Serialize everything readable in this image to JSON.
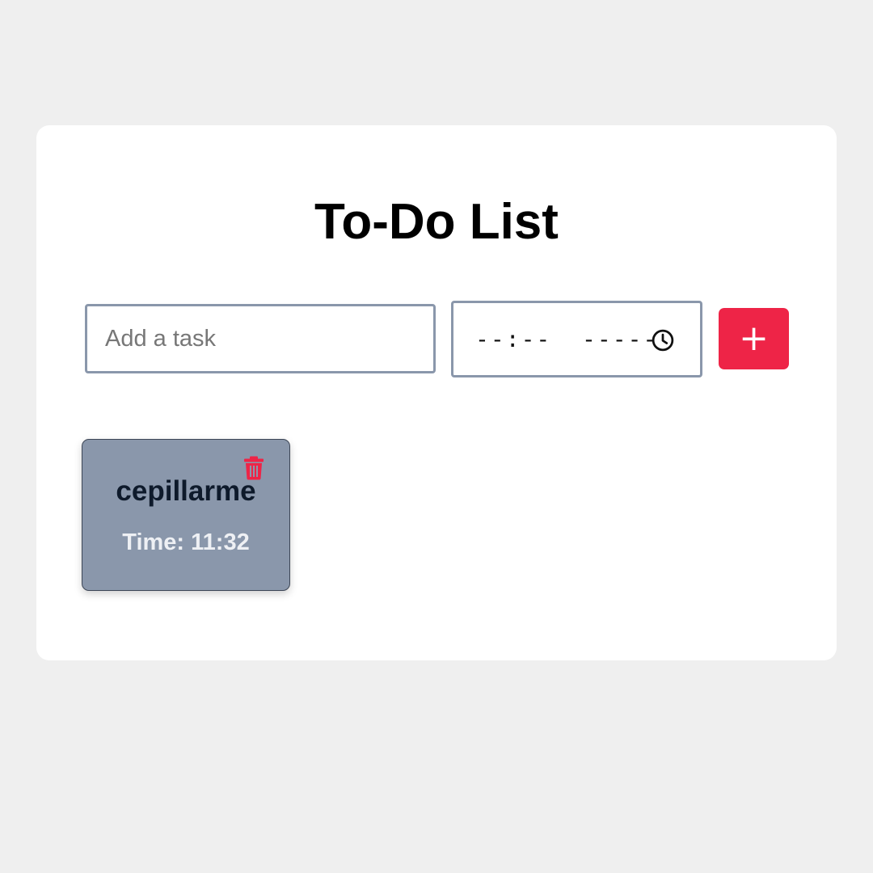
{
  "app": {
    "title": "To-Do List"
  },
  "form": {
    "task_placeholder": "Add a task",
    "time_display": "--:--  -----",
    "add_button_label": "+"
  },
  "tasks": [
    {
      "name": "cepillarme",
      "time_text": "Time: 11:32"
    }
  ],
  "colors": {
    "background": "#efefef",
    "card": "#ffffff",
    "input_border": "#8a97ab",
    "accent": "#ee2447",
    "task_card": "#8a97ab",
    "task_name": "#0e1a2b",
    "task_time": "#eef0f4"
  },
  "icons": {
    "time_picker": "clock-icon",
    "delete": "trash-icon"
  }
}
